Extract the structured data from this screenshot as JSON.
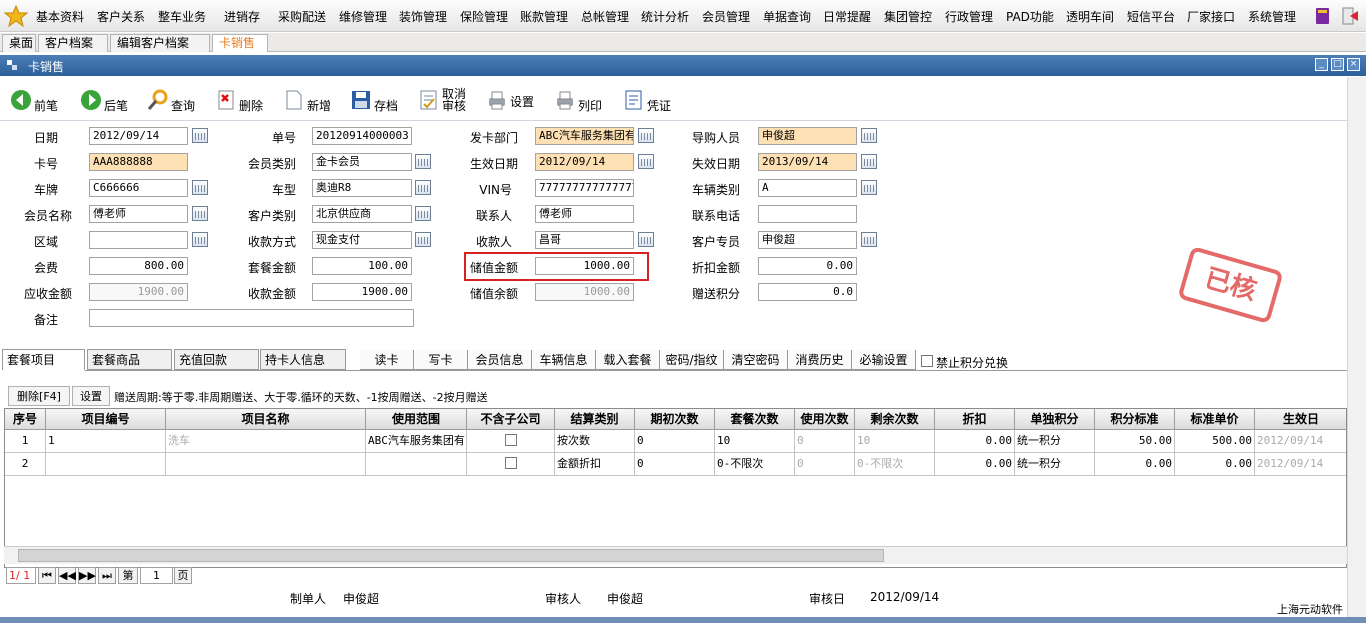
{
  "menu": [
    "基本资料",
    "客户关系",
    "整车业务",
    "进销存",
    "采购配送",
    "维修管理",
    "装饰管理",
    "保险管理",
    "账款管理",
    "总帐管理",
    "统计分析",
    "会员管理",
    "单据查询",
    "日常提醒",
    "集团管控",
    "行政管理",
    "PAD功能",
    "透明车间",
    "短信平台",
    "厂家接口",
    "系统管理"
  ],
  "tabs": [
    "桌面",
    "客户档案",
    "编辑客户档案",
    "卡销售"
  ],
  "window": {
    "title": "卡销售"
  },
  "toolbar": [
    "前笔",
    "后笔",
    "查询",
    "删除",
    "新增",
    "存档",
    "取消\n审核",
    "设置",
    "列印",
    "凭证"
  ],
  "form": {
    "col1": [
      {
        "label": "日期",
        "value": "2012/09/14"
      },
      {
        "label": "卡号",
        "value": "AAA888888"
      },
      {
        "label": "车牌",
        "value": "C666666"
      },
      {
        "label": "会员名称",
        "value": "傅老师"
      },
      {
        "label": "区域",
        "value": ""
      },
      {
        "label": "会费",
        "value": "800.00"
      },
      {
        "label": "应收金额",
        "value": "1900.00"
      },
      {
        "label": "备注",
        "value": ""
      }
    ],
    "col2": [
      {
        "label": "单号",
        "value": "20120914000003"
      },
      {
        "label": "会员类别",
        "value": "金卡会员"
      },
      {
        "label": "车型",
        "value": "奥迪R8"
      },
      {
        "label": "客户类别",
        "value": "北京供应商"
      },
      {
        "label": "收款方式",
        "value": "现金支付"
      },
      {
        "label": "套餐金额",
        "value": "100.00"
      },
      {
        "label": "收款金额",
        "value": "1900.00"
      }
    ],
    "col3": [
      {
        "label": "发卡部门",
        "value": "ABC汽车服务集团有"
      },
      {
        "label": "生效日期",
        "value": "2012/09/14"
      },
      {
        "label": "VIN号",
        "value": "77777777777777777"
      },
      {
        "label": "联系人",
        "value": "傅老师"
      },
      {
        "label": "收款人",
        "value": "昌哥"
      },
      {
        "label": "储值金额",
        "value": "1000.00"
      },
      {
        "label": "储值余额",
        "value": "1000.00"
      }
    ],
    "col4": [
      {
        "label": "导购人员",
        "value": "申俊超"
      },
      {
        "label": "失效日期",
        "value": "2013/09/14"
      },
      {
        "label": "车辆类别",
        "value": "A"
      },
      {
        "label": "联系电话",
        "value": ""
      },
      {
        "label": "客户专员",
        "value": "申俊超"
      },
      {
        "label": "折扣金额",
        "value": "0.00"
      },
      {
        "label": "赠送积分",
        "value": "0.0"
      }
    ],
    "stamp": "已核"
  },
  "subtabs": [
    "套餐项目",
    "套餐商品",
    "充值回款",
    "持卡人信息"
  ],
  "actions": [
    "读卡",
    "写卡",
    "会员信息",
    "车辆信息",
    "载入套餐",
    "密码/指纹",
    "清空密码",
    "消费历史",
    "必输设置"
  ],
  "no_points_exchange": "禁止积分兑换",
  "subtoolbar": {
    "delete": "删除[F4]",
    "settings": "设置",
    "hint": "赠送周期:等于零.非周期赠送、大于零.循环的天数、-1按周赠送、-2按月赠送"
  },
  "grid": {
    "columns": [
      "序号",
      "项目编号",
      "项目名称",
      "使用范围",
      "不含子公司",
      "结算类别",
      "期初次数",
      "套餐次数",
      "使用次数",
      "剩余次数",
      "折扣",
      "单独积分",
      "积分标准",
      "标准单价",
      "生效日"
    ],
    "rows": [
      [
        "1",
        "1",
        "洗车",
        "ABC汽车服务集团有",
        "",
        "按次数",
        "0",
        "10",
        "0",
        "10",
        "0.00",
        "统一积分",
        "50.00",
        "500.00",
        "2012/09/14"
      ],
      [
        "2",
        "",
        "",
        "",
        "",
        "金额折扣",
        "0",
        "0-不限次",
        "0",
        "0-不限次",
        "0.00",
        "统一积分",
        "0.00",
        "0.00",
        "2012/09/14"
      ]
    ]
  },
  "pager": {
    "info": "1/ 1",
    "page_label": "第",
    "page": "1",
    "page_unit": "页"
  },
  "footer": {
    "maker_label": "制单人",
    "maker": "申俊超",
    "auditor_label": "审核人",
    "auditor": "申俊超",
    "audit_date_label": "审核日",
    "audit_date": "2012/09/14",
    "company": "上海元动软件"
  }
}
